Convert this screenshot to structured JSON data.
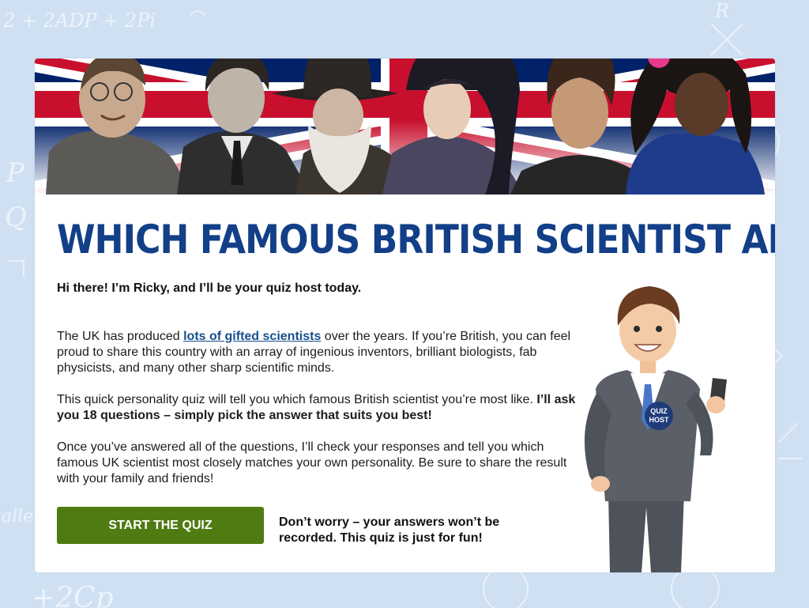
{
  "page": {
    "title": "WHICH FAMOUS BRITISH SCIENTIST ARE YOU?",
    "intro": "Hi there! I’m Ricky, and I’ll be your quiz host today.",
    "paragraph1": {
      "before": "The UK has produced ",
      "link": "lots of gifted scientists",
      "after": " over the years. If you’re British, you can feel proud to share this country with an array of ingenious inventors, brilliant biologists, fab physicists, and many other sharp scientific minds."
    },
    "paragraph2": {
      "before": "This quick personality quiz will tell you which famous British scientist you’re most like. ",
      "bold": "I’ll ask you 18 questions – simply pick the answer that suits you best!"
    },
    "paragraph3": "Once you’ve answered all of the questions, I’ll check your responses and tell you which famous UK scientist most closely matches your own personality. Be sure to share the result with your family and friends!",
    "start_button": "START THE QUIZ",
    "disclaimer": "Don’t worry – your answers won’t be recorded. This quiz is just for fun!",
    "host_badge": [
      "QUIZ",
      "HOST"
    ],
    "background_doodles": [
      "2 + 2ADP + 2Pi",
      "P",
      "Q",
      "R",
      "+2Cp",
      "alle"
    ]
  },
  "colors": {
    "background": "#cfe0f3",
    "title": "#123f88",
    "link": "#174f8f",
    "button": "#4f7b12",
    "flag_blue": "#012169",
    "flag_red": "#c8102e"
  },
  "icons": [
    "union-flag-banner",
    "scientist-portrait",
    "quiz-host-illustration"
  ]
}
